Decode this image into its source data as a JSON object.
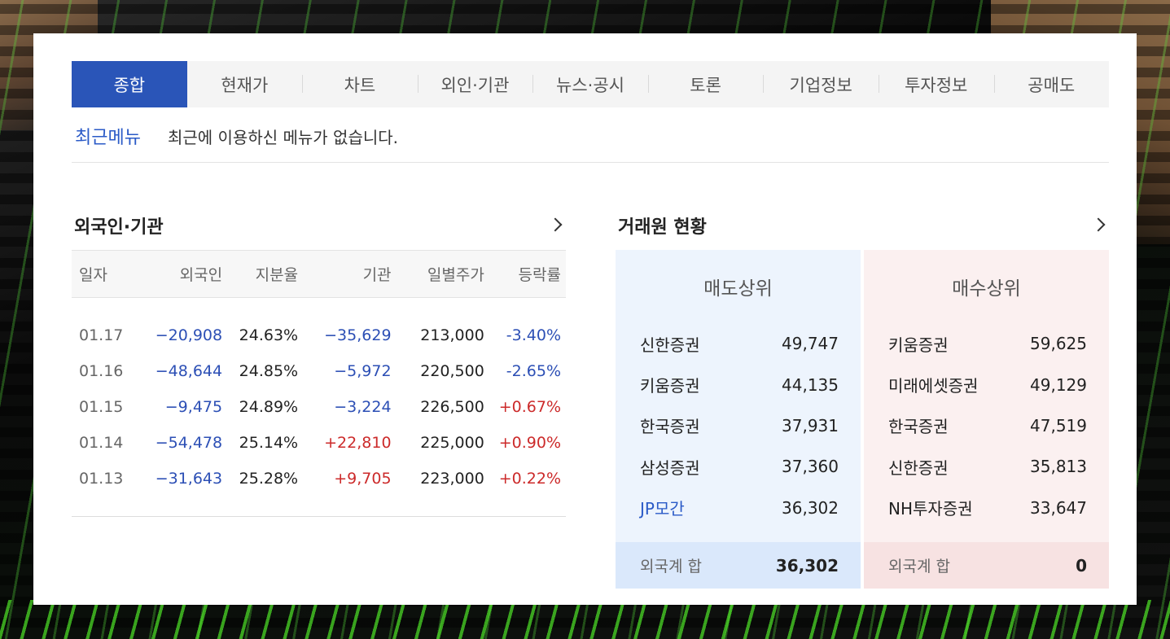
{
  "tabs": [
    "종합",
    "현재가",
    "차트",
    "외인·기관",
    "뉴스·공시",
    "토론",
    "기업정보",
    "투자정보",
    "공매도"
  ],
  "active_tab": "종합",
  "recent_menu": {
    "label": "최근메뉴",
    "message": "최근에 이용하신 메뉴가 없습니다."
  },
  "foreign_institution": {
    "title": "외국인·기관",
    "columns": [
      "일자",
      "외국인",
      "지분율",
      "기관",
      "일별주가",
      "등락률"
    ],
    "rows": [
      {
        "date": "01.17",
        "foreign": "−20,908",
        "ratio": "24.63%",
        "inst": "−35,629",
        "price": "213,000",
        "change": "-3.40%"
      },
      {
        "date": "01.16",
        "foreign": "−48,644",
        "ratio": "24.85%",
        "inst": "−5,972",
        "price": "220,500",
        "change": "-2.65%"
      },
      {
        "date": "01.15",
        "foreign": "−9,475",
        "ratio": "24.89%",
        "inst": "−3,224",
        "price": "226,500",
        "change": "+0.67%"
      },
      {
        "date": "01.14",
        "foreign": "−54,478",
        "ratio": "25.14%",
        "inst": "+22,810",
        "price": "225,000",
        "change": "+0.90%"
      },
      {
        "date": "01.13",
        "foreign": "−31,643",
        "ratio": "25.28%",
        "inst": "+9,705",
        "price": "223,000",
        "change": "+0.22%"
      }
    ]
  },
  "brokers": {
    "title": "거래원 현황",
    "sell": {
      "header": "매도상위",
      "rows": [
        {
          "name": "신한증권",
          "value": "49,747"
        },
        {
          "name": "키움증권",
          "value": "44,135"
        },
        {
          "name": "한국증권",
          "value": "37,931"
        },
        {
          "name": "삼성증권",
          "value": "37,360"
        },
        {
          "name": "JP모간",
          "value": "36,302"
        }
      ],
      "footer_label": "외국계 합",
      "footer_value": "36,302"
    },
    "buy": {
      "header": "매수상위",
      "rows": [
        {
          "name": "키움증권",
          "value": "59,625"
        },
        {
          "name": "미래에셋증권",
          "value": "49,129"
        },
        {
          "name": "한국증권",
          "value": "47,519"
        },
        {
          "name": "신한증권",
          "value": "35,813"
        },
        {
          "name": "NH투자증권",
          "value": "33,647"
        }
      ],
      "footer_label": "외국계 합",
      "footer_value": "0"
    }
  },
  "colors": {
    "accent": "#2a55b8",
    "negative": "#2c4fb5",
    "positive": "#cc2a2a"
  }
}
